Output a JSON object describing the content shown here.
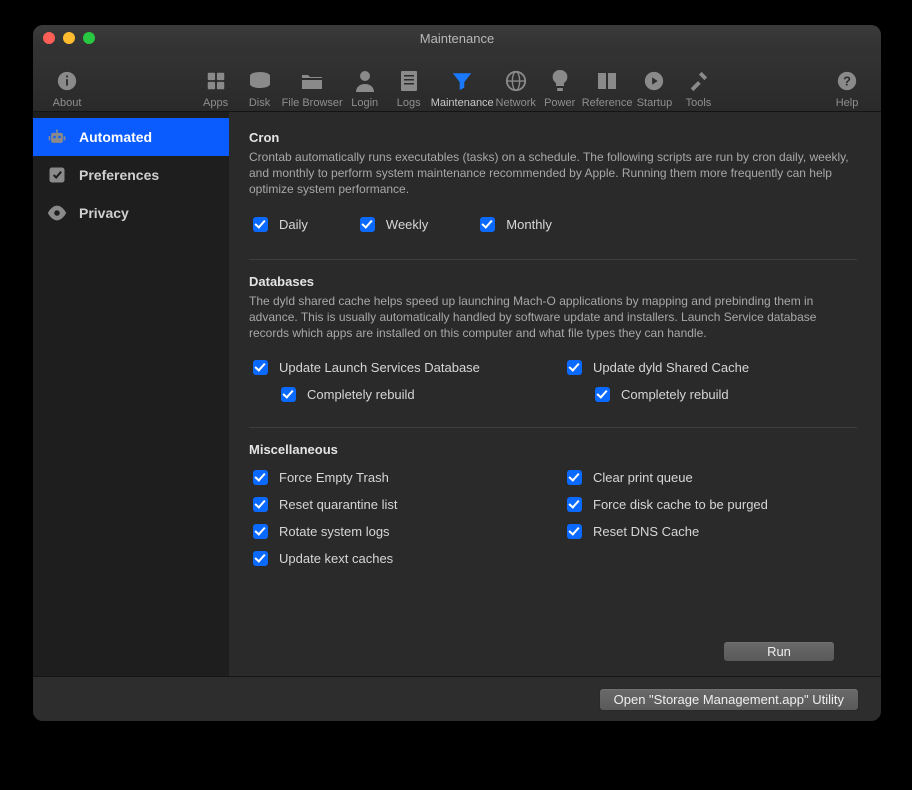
{
  "window": {
    "title": "Maintenance"
  },
  "toolbar": {
    "about": "About",
    "apps": "Apps",
    "disk": "Disk",
    "file_browser": "File Browser",
    "login": "Login",
    "logs": "Logs",
    "maintenance": "Maintenance",
    "network": "Network",
    "power": "Power",
    "reference": "Reference",
    "startup": "Startup",
    "tools": "Tools",
    "help": "Help"
  },
  "sidebar": {
    "items": [
      {
        "label": "Automated",
        "selected": true
      },
      {
        "label": "Preferences",
        "selected": false
      },
      {
        "label": "Privacy",
        "selected": false
      }
    ]
  },
  "sections": {
    "cron": {
      "title": "Cron",
      "desc": "Crontab automatically runs executables (tasks) on a schedule. The following scripts are run by cron daily, weekly, and monthly to perform system maintenance recommended by Apple. Running them more frequently can help optimize system performance.",
      "daily": "Daily",
      "weekly": "Weekly",
      "monthly": "Monthly"
    },
    "databases": {
      "title": "Databases",
      "desc": "The dyld shared cache helps speed up launching Mach-O applications by mapping and prebinding them in advance. This is usually automatically handled by software update and installers. Launch Service database records which apps are installed on this computer and what file types they can handle.",
      "update_launch": "Update Launch Services Database",
      "update_dyld": "Update dyld Shared Cache",
      "completely_rebuild": "Completely rebuild"
    },
    "misc": {
      "title": "Miscellaneous",
      "force_empty_trash": "Force Empty Trash",
      "reset_quarantine": "Reset quarantine list",
      "rotate_logs": "Rotate system logs",
      "update_kext": "Update kext caches",
      "clear_print": "Clear print queue",
      "force_disk_cache": "Force disk cache to be purged",
      "reset_dns": "Reset DNS Cache"
    }
  },
  "buttons": {
    "run": "Run",
    "open_storage": "Open \"Storage Management.app\" Utility"
  }
}
